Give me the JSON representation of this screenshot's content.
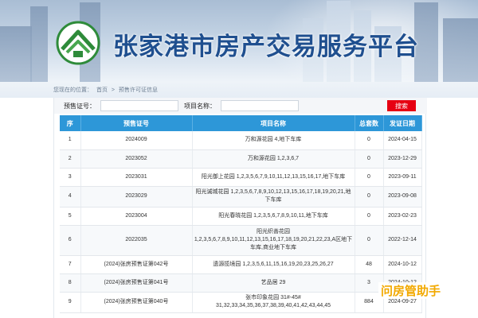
{
  "site": {
    "title": "张家港市房产交易服务平台"
  },
  "breadcrumb": {
    "prefix": "您现在的位置：",
    "home": "首页",
    "sep": ">",
    "current": "预售许可证信息"
  },
  "search": {
    "presale_label": "预售证号：",
    "presale_value": "",
    "project_label": "项目名称：",
    "project_value": "",
    "button_label": "搜索"
  },
  "table": {
    "headers": [
      "序",
      "预售证号",
      "项目名称",
      "总套数",
      "发证日期"
    ],
    "rows": [
      [
        "1",
        "2024009",
        "万和源花园 4,地下车库",
        "0",
        "2024-04-15"
      ],
      [
        "2",
        "2023052",
        "万和源花园 1,2,3,6,7",
        "0",
        "2023-12-29"
      ],
      [
        "3",
        "2023031",
        "阳光御上花园 1,2,3,5,6,7,9,10,11,12,13,15,16,17,地下车库",
        "0",
        "2023-09-11"
      ],
      [
        "4",
        "2023029",
        "阳光诚城花园 1,2,3,5,6,7,8,9,10,12,13,15,16,17,18,19,20,21,地下车库",
        "0",
        "2023-09-08"
      ],
      [
        "5",
        "2023004",
        "阳光春晓花园 1,2,3,5,6,7,8,9,10,11,地下车库",
        "0",
        "2023-02-23"
      ],
      [
        "6",
        "2022035",
        "阳光织善花园 1,2,3,5,6,7,8,9,10,11,12,13,15,16,17,18,19,20,21,22,23,A区地下车库,商业地下车库",
        "0",
        "2022-12-14"
      ],
      [
        "7",
        "(2024)张房预售证第042号",
        "遗源揽境园 1,2,3,5,6,11,15,16,19,20,23,25,26,27",
        "48",
        "2024-10-12"
      ],
      [
        "8",
        "(2024)张房预售证第041号",
        "艺品居 29",
        "3",
        "2024-10-12"
      ],
      [
        "9",
        "(2024)张房预售证第040号",
        "张市印象花园 31#-45# 31,32,33,34,35,36,37,38,39,40,41,42,43,44,45",
        "884",
        "2024-09-27"
      ]
    ]
  },
  "watermark": "问房管助手",
  "colors": {
    "title": "#1f4f8f",
    "table_header": "#2d97d8",
    "search_button": "#e60012",
    "watermark": "#f2a900"
  },
  "icons": {
    "logo": "house-logo-icon"
  }
}
